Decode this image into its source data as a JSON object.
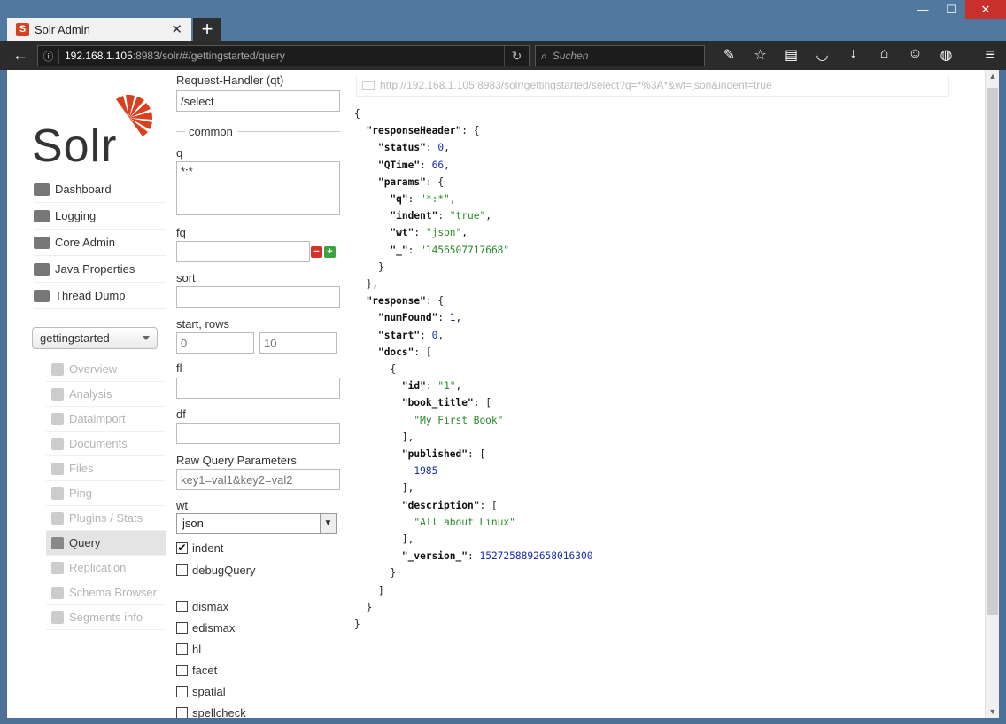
{
  "browser": {
    "tab_title": "Solr Admin",
    "url_host": "192.168.1.105",
    "url_rest": ":8983/solr/#/gettingstarted/query",
    "search_placeholder": "Suchen"
  },
  "logo_text": "Solr",
  "nav": [
    {
      "label": "Dashboard",
      "icon": "dashboard-icon"
    },
    {
      "label": "Logging",
      "icon": "logging-icon"
    },
    {
      "label": "Core Admin",
      "icon": "core-admin-icon"
    },
    {
      "label": "Java Properties",
      "icon": "java-properties-icon"
    },
    {
      "label": "Thread Dump",
      "icon": "thread-dump-icon"
    }
  ],
  "core_selector": {
    "selected": "gettingstarted"
  },
  "core_menu": [
    {
      "label": "Overview",
      "active": false
    },
    {
      "label": "Analysis",
      "active": false
    },
    {
      "label": "Dataimport",
      "active": false
    },
    {
      "label": "Documents",
      "active": false
    },
    {
      "label": "Files",
      "active": false
    },
    {
      "label": "Ping",
      "active": false
    },
    {
      "label": "Plugins / Stats",
      "active": false
    },
    {
      "label": "Query",
      "active": true
    },
    {
      "label": "Replication",
      "active": false
    },
    {
      "label": "Schema Browser",
      "active": false
    },
    {
      "label": "Segments info",
      "active": false
    }
  ],
  "form": {
    "qt_label": "Request-Handler (qt)",
    "qt_value": "/select",
    "section_common": "common",
    "q_label": "q",
    "q_value": "*:*",
    "fq_label": "fq",
    "sort_label": "sort",
    "start_rows_label": "start, rows",
    "start_placeholder": "0",
    "rows_placeholder": "10",
    "fl_label": "fl",
    "df_label": "df",
    "raw_label": "Raw Query Parameters",
    "raw_placeholder": "key1=val1&key2=val2",
    "wt_label": "wt",
    "wt_value": "json",
    "indent_label": "indent",
    "indent_checked": true,
    "debug_label": "debugQuery",
    "options": [
      "dismax",
      "edismax",
      "hl",
      "facet",
      "spatial",
      "spellcheck"
    ]
  },
  "result": {
    "request_url": "http://192.168.1.105:8983/solr/gettingstarted/select?q=*%3A*&wt=json&indent=true",
    "response": {
      "status": 0,
      "QTime": 66,
      "params": {
        "q": "*:*",
        "indent": "true",
        "wt": "json",
        "_": "1456507717668"
      },
      "numFound": 1,
      "start": 0,
      "doc": {
        "id": "1",
        "book_title": "My First Book",
        "published": 1985,
        "description": "All about Linux",
        "_version_": "1527258892658016300"
      }
    }
  }
}
